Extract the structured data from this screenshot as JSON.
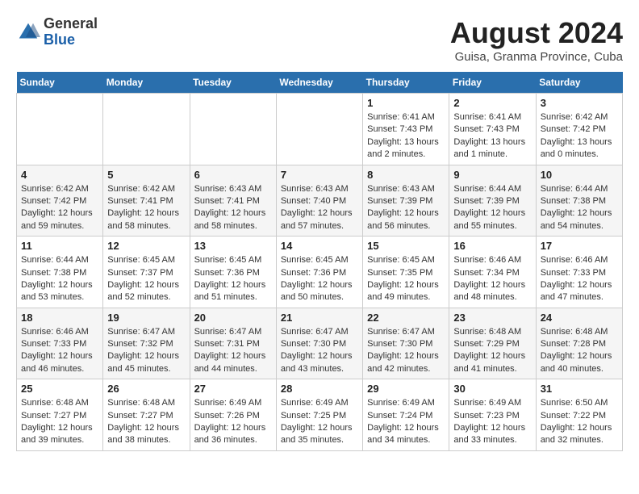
{
  "header": {
    "logo_general": "General",
    "logo_blue": "Blue",
    "month_title": "August 2024",
    "subtitle": "Guisa, Granma Province, Cuba"
  },
  "days_of_week": [
    "Sunday",
    "Monday",
    "Tuesday",
    "Wednesday",
    "Thursday",
    "Friday",
    "Saturday"
  ],
  "weeks": [
    [
      {
        "day": "",
        "info": ""
      },
      {
        "day": "",
        "info": ""
      },
      {
        "day": "",
        "info": ""
      },
      {
        "day": "",
        "info": ""
      },
      {
        "day": "1",
        "sunrise": "Sunrise: 6:41 AM",
        "sunset": "Sunset: 7:43 PM",
        "daylight": "Daylight: 13 hours and 2 minutes."
      },
      {
        "day": "2",
        "sunrise": "Sunrise: 6:41 AM",
        "sunset": "Sunset: 7:43 PM",
        "daylight": "Daylight: 13 hours and 1 minute."
      },
      {
        "day": "3",
        "sunrise": "Sunrise: 6:42 AM",
        "sunset": "Sunset: 7:42 PM",
        "daylight": "Daylight: 13 hours and 0 minutes."
      }
    ],
    [
      {
        "day": "4",
        "sunrise": "Sunrise: 6:42 AM",
        "sunset": "Sunset: 7:42 PM",
        "daylight": "Daylight: 12 hours and 59 minutes."
      },
      {
        "day": "5",
        "sunrise": "Sunrise: 6:42 AM",
        "sunset": "Sunset: 7:41 PM",
        "daylight": "Daylight: 12 hours and 58 minutes."
      },
      {
        "day": "6",
        "sunrise": "Sunrise: 6:43 AM",
        "sunset": "Sunset: 7:41 PM",
        "daylight": "Daylight: 12 hours and 58 minutes."
      },
      {
        "day": "7",
        "sunrise": "Sunrise: 6:43 AM",
        "sunset": "Sunset: 7:40 PM",
        "daylight": "Daylight: 12 hours and 57 minutes."
      },
      {
        "day": "8",
        "sunrise": "Sunrise: 6:43 AM",
        "sunset": "Sunset: 7:39 PM",
        "daylight": "Daylight: 12 hours and 56 minutes."
      },
      {
        "day": "9",
        "sunrise": "Sunrise: 6:44 AM",
        "sunset": "Sunset: 7:39 PM",
        "daylight": "Daylight: 12 hours and 55 minutes."
      },
      {
        "day": "10",
        "sunrise": "Sunrise: 6:44 AM",
        "sunset": "Sunset: 7:38 PM",
        "daylight": "Daylight: 12 hours and 54 minutes."
      }
    ],
    [
      {
        "day": "11",
        "sunrise": "Sunrise: 6:44 AM",
        "sunset": "Sunset: 7:38 PM",
        "daylight": "Daylight: 12 hours and 53 minutes."
      },
      {
        "day": "12",
        "sunrise": "Sunrise: 6:45 AM",
        "sunset": "Sunset: 7:37 PM",
        "daylight": "Daylight: 12 hours and 52 minutes."
      },
      {
        "day": "13",
        "sunrise": "Sunrise: 6:45 AM",
        "sunset": "Sunset: 7:36 PM",
        "daylight": "Daylight: 12 hours and 51 minutes."
      },
      {
        "day": "14",
        "sunrise": "Sunrise: 6:45 AM",
        "sunset": "Sunset: 7:36 PM",
        "daylight": "Daylight: 12 hours and 50 minutes."
      },
      {
        "day": "15",
        "sunrise": "Sunrise: 6:45 AM",
        "sunset": "Sunset: 7:35 PM",
        "daylight": "Daylight: 12 hours and 49 minutes."
      },
      {
        "day": "16",
        "sunrise": "Sunrise: 6:46 AM",
        "sunset": "Sunset: 7:34 PM",
        "daylight": "Daylight: 12 hours and 48 minutes."
      },
      {
        "day": "17",
        "sunrise": "Sunrise: 6:46 AM",
        "sunset": "Sunset: 7:33 PM",
        "daylight": "Daylight: 12 hours and 47 minutes."
      }
    ],
    [
      {
        "day": "18",
        "sunrise": "Sunrise: 6:46 AM",
        "sunset": "Sunset: 7:33 PM",
        "daylight": "Daylight: 12 hours and 46 minutes."
      },
      {
        "day": "19",
        "sunrise": "Sunrise: 6:47 AM",
        "sunset": "Sunset: 7:32 PM",
        "daylight": "Daylight: 12 hours and 45 minutes."
      },
      {
        "day": "20",
        "sunrise": "Sunrise: 6:47 AM",
        "sunset": "Sunset: 7:31 PM",
        "daylight": "Daylight: 12 hours and 44 minutes."
      },
      {
        "day": "21",
        "sunrise": "Sunrise: 6:47 AM",
        "sunset": "Sunset: 7:30 PM",
        "daylight": "Daylight: 12 hours and 43 minutes."
      },
      {
        "day": "22",
        "sunrise": "Sunrise: 6:47 AM",
        "sunset": "Sunset: 7:30 PM",
        "daylight": "Daylight: 12 hours and 42 minutes."
      },
      {
        "day": "23",
        "sunrise": "Sunrise: 6:48 AM",
        "sunset": "Sunset: 7:29 PM",
        "daylight": "Daylight: 12 hours and 41 minutes."
      },
      {
        "day": "24",
        "sunrise": "Sunrise: 6:48 AM",
        "sunset": "Sunset: 7:28 PM",
        "daylight": "Daylight: 12 hours and 40 minutes."
      }
    ],
    [
      {
        "day": "25",
        "sunrise": "Sunrise: 6:48 AM",
        "sunset": "Sunset: 7:27 PM",
        "daylight": "Daylight: 12 hours and 39 minutes."
      },
      {
        "day": "26",
        "sunrise": "Sunrise: 6:48 AM",
        "sunset": "Sunset: 7:27 PM",
        "daylight": "Daylight: 12 hours and 38 minutes."
      },
      {
        "day": "27",
        "sunrise": "Sunrise: 6:49 AM",
        "sunset": "Sunset: 7:26 PM",
        "daylight": "Daylight: 12 hours and 36 minutes."
      },
      {
        "day": "28",
        "sunrise": "Sunrise: 6:49 AM",
        "sunset": "Sunset: 7:25 PM",
        "daylight": "Daylight: 12 hours and 35 minutes."
      },
      {
        "day": "29",
        "sunrise": "Sunrise: 6:49 AM",
        "sunset": "Sunset: 7:24 PM",
        "daylight": "Daylight: 12 hours and 34 minutes."
      },
      {
        "day": "30",
        "sunrise": "Sunrise: 6:49 AM",
        "sunset": "Sunset: 7:23 PM",
        "daylight": "Daylight: 12 hours and 33 minutes."
      },
      {
        "day": "31",
        "sunrise": "Sunrise: 6:50 AM",
        "sunset": "Sunset: 7:22 PM",
        "daylight": "Daylight: 12 hours and 32 minutes."
      }
    ]
  ]
}
